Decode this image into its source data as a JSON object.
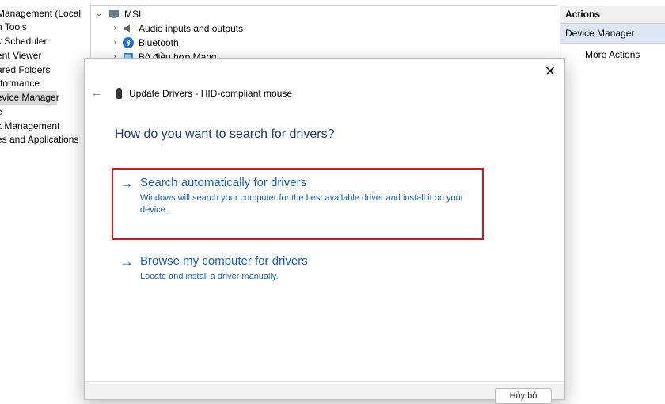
{
  "left_pane": {
    "items": [
      {
        "label": "Management (Local",
        "selected": false
      },
      {
        "label": "n Tools",
        "selected": false
      },
      {
        "label": "k Scheduler",
        "selected": false
      },
      {
        "label": "ent Viewer",
        "selected": false
      },
      {
        "label": "ared Folders",
        "selected": false
      },
      {
        "label": "rformance",
        "selected": false
      },
      {
        "label": "evice Manager",
        "selected": true
      },
      {
        "label": "e",
        "selected": false
      },
      {
        "label": "k Management",
        "selected": false
      },
      {
        "label": "es and Applications",
        "selected": false
      }
    ]
  },
  "tree": {
    "root": "MSI",
    "children": [
      {
        "label": "Audio inputs and outputs",
        "icon": "speaker-icon"
      },
      {
        "label": "Bluetooth",
        "icon": "bluetooth-icon"
      },
      {
        "label": "Bộ điều hợp Mạng",
        "icon": "network-adapter-icon"
      }
    ]
  },
  "actions": {
    "header": "Actions",
    "section": "Device Manager",
    "more": "More Actions"
  },
  "dialog": {
    "title": "Update Drivers - HID-compliant mouse",
    "question": "How do you want to search for drivers?",
    "options": [
      {
        "title": "Search automatically for drivers",
        "description": "Windows will search your computer for the best available driver and install it on your device."
      },
      {
        "title": "Browse my computer for drivers",
        "description": "Locate and install a driver manually."
      }
    ],
    "cancel_label": "Hủy bỏ",
    "close_glyph": "✕",
    "back_glyph": "←",
    "arrow_glyph": "→"
  },
  "colors": {
    "link_blue": "#1a5fb4",
    "highlight_red": "#e0101f",
    "question_blue": "#1f3a6e"
  }
}
